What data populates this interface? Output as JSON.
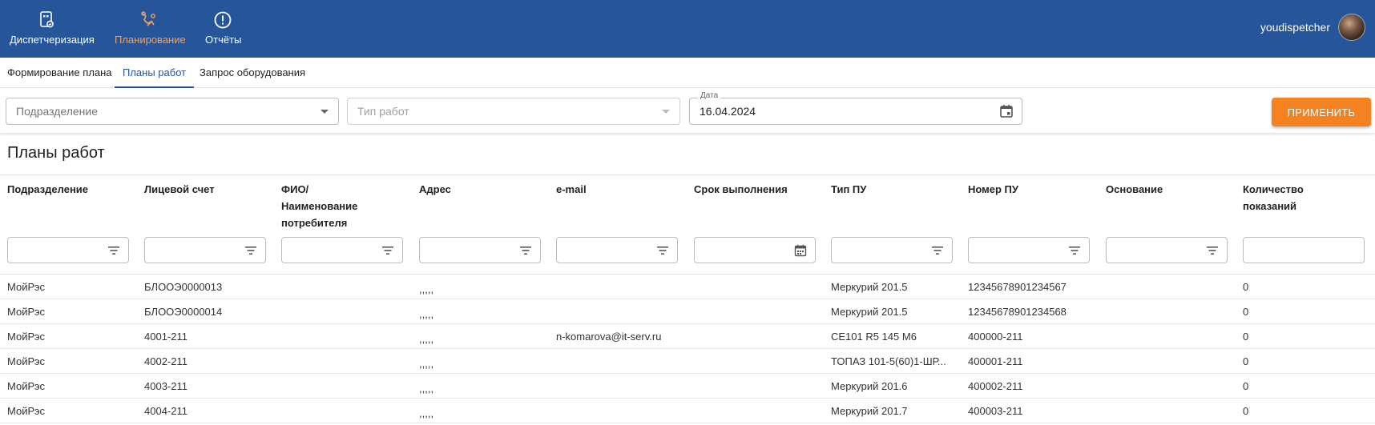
{
  "nav": {
    "items": [
      {
        "label": "Диспетчеризация",
        "icon": "dispatch-icon"
      },
      {
        "label": "Планирование",
        "icon": "planning-icon",
        "active": true
      },
      {
        "label": "Отчёты",
        "icon": "reports-icon"
      }
    ],
    "user": "youdispetcher"
  },
  "subtabs": [
    {
      "label": "Формирование плана"
    },
    {
      "label": "Планы работ",
      "active": true
    },
    {
      "label": "Запрос оборудования"
    }
  ],
  "filters": {
    "division_placeholder": "Подразделение",
    "worktype_placeholder": "Тип работ",
    "date_label": "Дата",
    "date_value": "16.04.2024",
    "apply_label": "Применить"
  },
  "page_title": "Планы работ",
  "table": {
    "columns": [
      "Подразделение",
      "Лицевой счет",
      "ФИО/\nНаименование\nпотребителя",
      "Адрес",
      "e-mail",
      "Срок выполнения",
      "Тип ПУ",
      "Номер ПУ",
      "Основание",
      "Количество\nпоказаний"
    ],
    "rows": [
      [
        "МойРэс",
        "БЛООЭ0000013",
        "",
        ",,,,,",
        "",
        "",
        "Меркурий 201.5",
        "12345678901234567",
        "",
        "0"
      ],
      [
        "МойРэс",
        "БЛООЭ0000014",
        "",
        ",,,,,",
        "",
        "",
        "Меркурий 201.5",
        "12345678901234568",
        "",
        "0"
      ],
      [
        "МойРэс",
        "4001-211",
        "",
        ",,,,,",
        "n-komarova@it-serv.ru",
        "",
        "CE101 R5 145 M6",
        "400000-211",
        "",
        "0"
      ],
      [
        "МойРэс",
        "4002-211",
        "",
        ",,,,,",
        "",
        "",
        "ТОПАЗ 101-5(60)1-ШР...",
        "400001-211",
        "",
        "0"
      ],
      [
        "МойРэс",
        "4003-211",
        "",
        ",,,,,",
        "",
        "",
        "Меркурий 201.6",
        "400002-211",
        "",
        "0"
      ],
      [
        "МойРэс",
        "4004-211",
        "",
        ",,,,,",
        "",
        "",
        "Меркурий 201.7",
        "400003-211",
        "",
        "0"
      ]
    ]
  },
  "colors": {
    "header": "#26559a",
    "accent": "#f58220",
    "active_nav": "#f2a25e"
  }
}
